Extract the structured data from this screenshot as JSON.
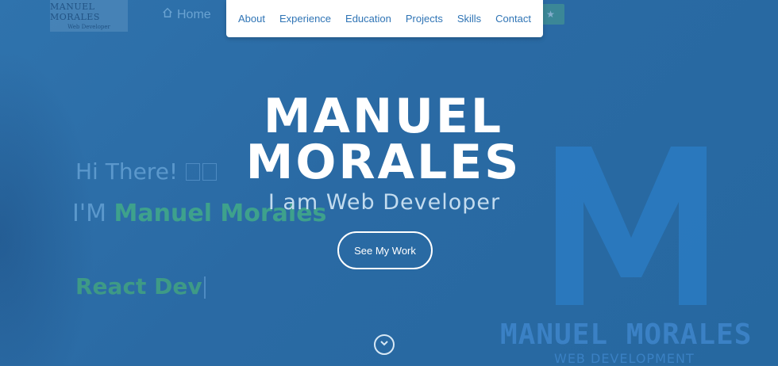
{
  "brand": {
    "logo_line1": "MANUEL MORALES",
    "logo_line2": "Web Developer"
  },
  "topbar": {
    "home_label": "Home",
    "home_icon": "home-icon",
    "faded_button_icon": "star-icon"
  },
  "nav": {
    "items": [
      "About",
      "Experience",
      "Education",
      "Projects",
      "Skills",
      "Contact"
    ]
  },
  "background": {
    "greeting": "Hi There!",
    "im_prefix": "I'M",
    "im_name": "Manuel Morales",
    "role": "React Dev",
    "logo_text": "MANUEL MORALES",
    "logo_sub": "WEB DEVELOPMENT"
  },
  "hero": {
    "title_line1": "MANUEL",
    "title_line2": "MORALES",
    "subtitle": "I am Web Developer",
    "cta_label": "See My Work",
    "scroll_icon": "chevron-down-icon"
  },
  "colors": {
    "background": "#2a6aa2",
    "accent_green": "#3ea18c",
    "nav_link": "#2f74b5"
  }
}
